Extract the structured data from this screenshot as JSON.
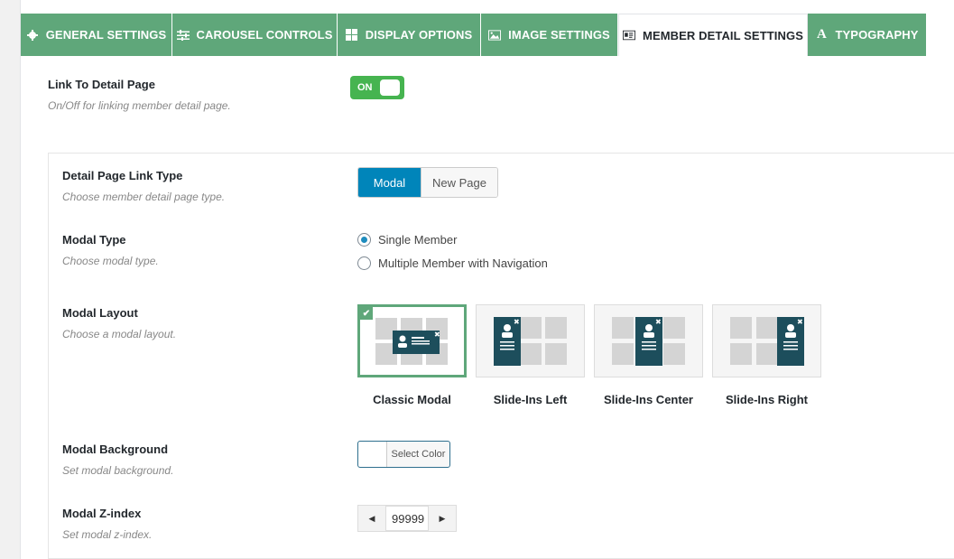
{
  "tabs": [
    {
      "label": "GENERAL SETTINGS",
      "icon": "gear-icon"
    },
    {
      "label": "CAROUSEL CONTROLS",
      "icon": "sliders-icon"
    },
    {
      "label": "DISPLAY OPTIONS",
      "icon": "grid-icon"
    },
    {
      "label": "IMAGE SETTINGS",
      "icon": "image-icon"
    },
    {
      "label": "MEMBER DETAIL SETTINGS",
      "icon": "id-card-icon",
      "active": true
    },
    {
      "label": "TYPOGRAPHY",
      "icon": "font-icon"
    }
  ],
  "link_detail": {
    "label": "Link To Detail Page",
    "desc": "On/Off for linking member detail page.",
    "toggle": "ON"
  },
  "link_type": {
    "label": "Detail Page Link Type",
    "desc": "Choose member detail page type.",
    "options": [
      "Modal",
      "New Page"
    ],
    "selected": "Modal"
  },
  "modal_type": {
    "label": "Modal Type",
    "desc": "Choose modal type.",
    "options": [
      "Single Member",
      "Multiple Member with Navigation"
    ],
    "selected": "Single Member"
  },
  "modal_layout": {
    "label": "Modal Layout",
    "desc": "Choose a modal layout.",
    "options": [
      "Classic Modal",
      "Slide-Ins Left",
      "Slide-Ins Center",
      "Slide-Ins Right"
    ],
    "selected": "Classic Modal"
  },
  "modal_bg": {
    "label": "Modal Background",
    "desc": "Set modal background.",
    "button": "Select Color"
  },
  "modal_z": {
    "label": "Modal Z-index",
    "desc": "Set modal z-index.",
    "value": "99999"
  },
  "colors": {
    "accent": "#5fa77a",
    "primary": "#0085ba",
    "toggle_on": "#46b450",
    "modal_dark": "#1d4e5c"
  }
}
